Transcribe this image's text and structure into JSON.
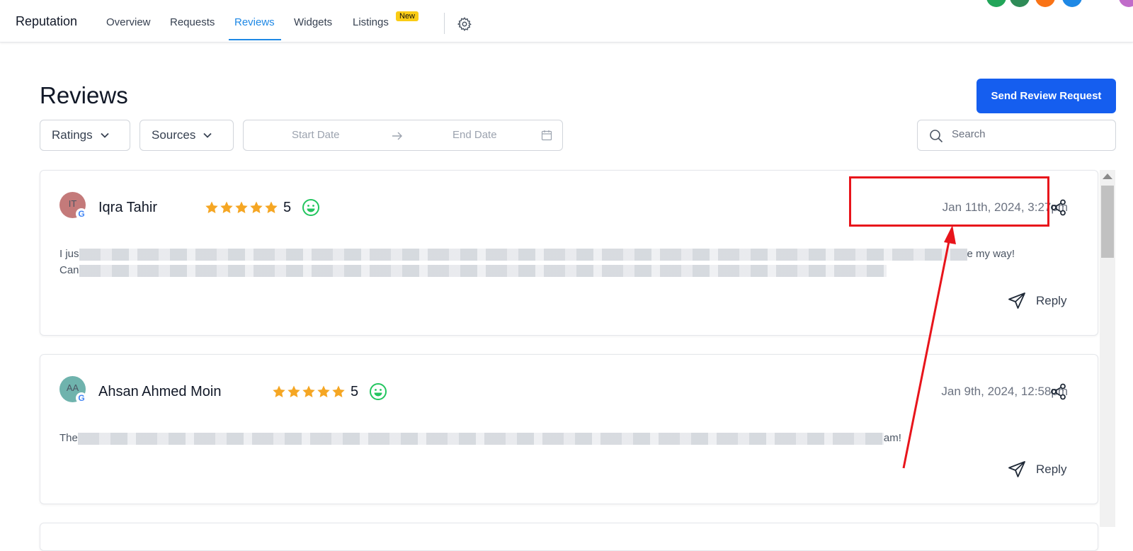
{
  "header": {
    "brand": "Reputation",
    "tabs": [
      {
        "label": "Overview"
      },
      {
        "label": "Requests"
      },
      {
        "label": "Reviews",
        "active": true
      },
      {
        "label": "Widgets"
      },
      {
        "label": "Listings",
        "badge": "New"
      }
    ],
    "settings_icon": "gear-icon"
  },
  "page": {
    "title": "Reviews",
    "send_request_label": "Send Review Request",
    "filters": {
      "ratings_label": "Ratings",
      "sources_label": "Sources",
      "start_date_placeholder": "Start Date",
      "end_date_placeholder": "End Date",
      "search_placeholder": "Search"
    }
  },
  "reviews": [
    {
      "initials": "IT",
      "avatar_color": "#c47a7a",
      "source": "Google",
      "name": "Iqra Tahir",
      "stars": 5,
      "rating": "5",
      "date": "Jan 11th, 2024, 3:27pm",
      "text_line1_start": "I jus",
      "text_line1_end": "e my way!",
      "text_line2_start": "Can",
      "reply_label": "Reply"
    },
    {
      "initials": "AA",
      "avatar_color": "#6fb3ad",
      "source": "Google",
      "name": "Ahsan Ahmed Moin",
      "stars": 5,
      "rating": "5",
      "date": "Jan 9th, 2024, 12:58pm",
      "text_line1_start": "The",
      "text_line1_end": "am!",
      "reply_label": "Reply"
    }
  ],
  "colors": {
    "accent": "#1e88e5",
    "primary_button": "#155eef",
    "star": "#f5a623",
    "smiley": "#22c55e",
    "annotation": "#e8141b"
  }
}
